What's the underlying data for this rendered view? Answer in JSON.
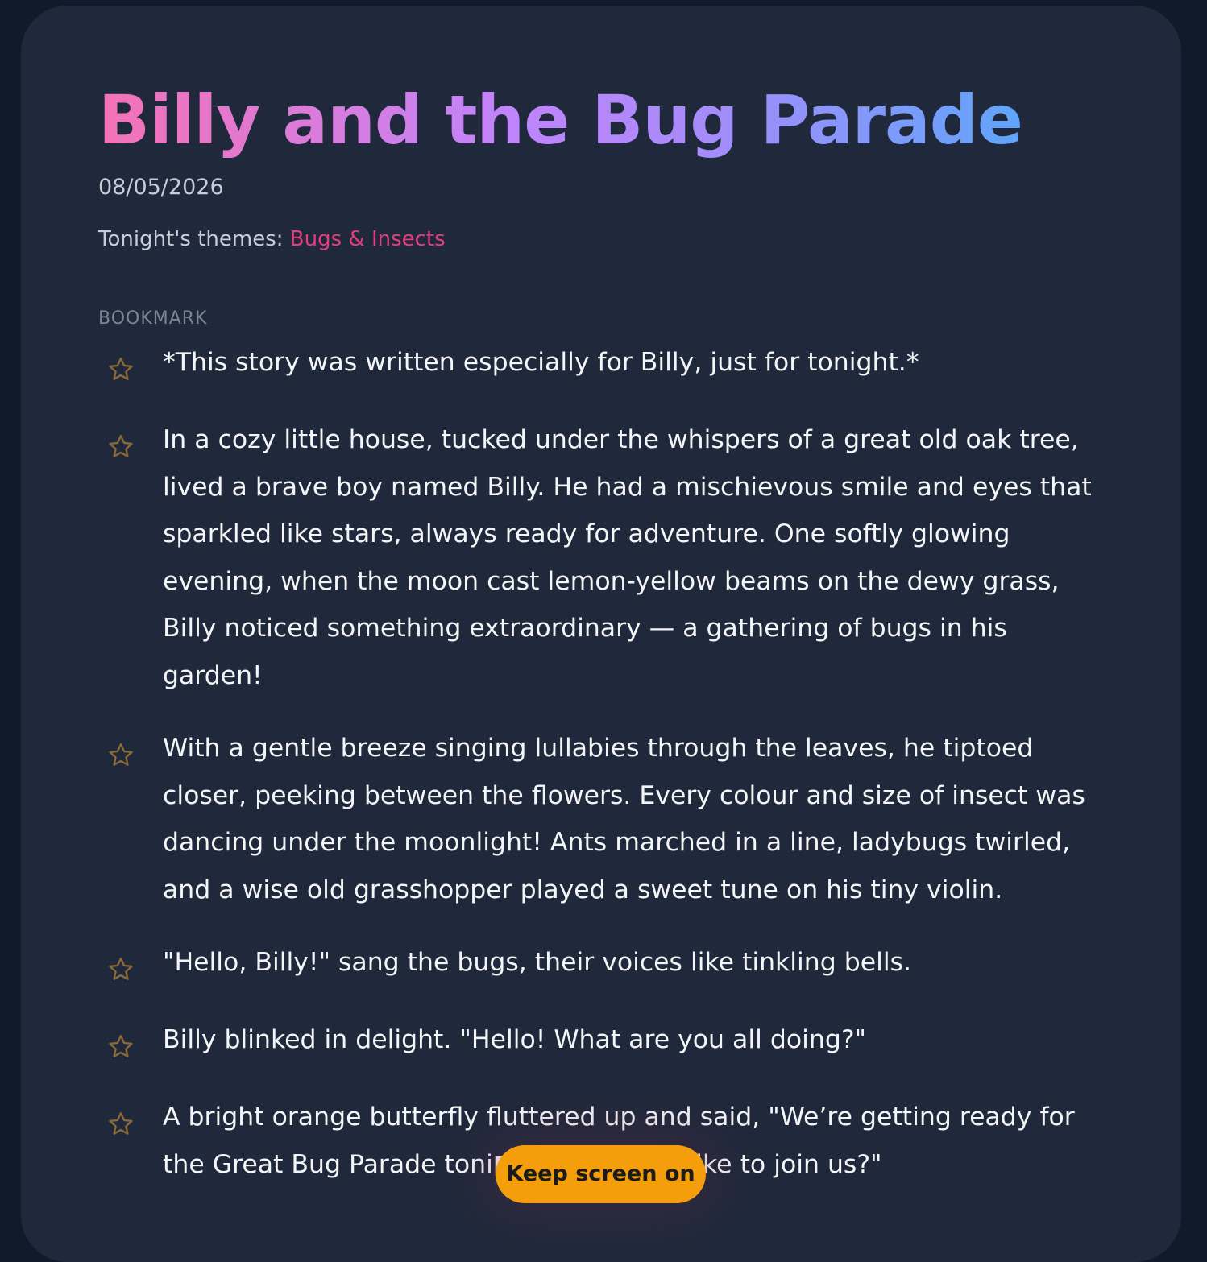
{
  "story": {
    "title": "Billy and the Bug Parade",
    "date": "08/05/2026",
    "themes_label": "Tonight's themes:",
    "themes_value": "Bugs & Insects",
    "bookmark_label": "BOOKMARK",
    "paragraphs": [
      "*This story was written especially for Billy, just for tonight.*",
      "In a cozy little house, tucked under the whispers of a great old oak tree, lived a brave boy named Billy. He had a mischievous smile and eyes that sparkled like stars, always ready for adventure. One softly glowing evening, when the moon cast lemon-yellow beams on the dewy grass, Billy noticed something extraordinary — a gathering of bugs in his garden!",
      "With a gentle breeze singing lullabies through the leaves, he tiptoed closer, peeking between the flowers. Every colour and size of insect was dancing under the moonlight! Ants marched in a line, ladybugs twirled, and a wise old grasshopper played a sweet tune on his tiny violin.",
      "\"Hello, Billy!\" sang the bugs, their voices like tinkling bells.",
      "Billy blinked in delight. \"Hello! What are you all doing?\"",
      "A bright orange butterfly fluttered up and said, \"We’re getting ready for the Great Bug Parade toni▮▮▮▮▮▮▮▮▮▮▮▮▮▮like to join us?\""
    ]
  },
  "keep_screen_on_label": "Keep screen on",
  "colors": {
    "page_bg": "#111a2a",
    "card_bg": "#1f293b",
    "accent_pink": "#e33d7e",
    "star_outline": "#8a6a3a",
    "button_bg": "#f59e0b"
  },
  "icons": {
    "bookmark": "star-outline-icon"
  }
}
